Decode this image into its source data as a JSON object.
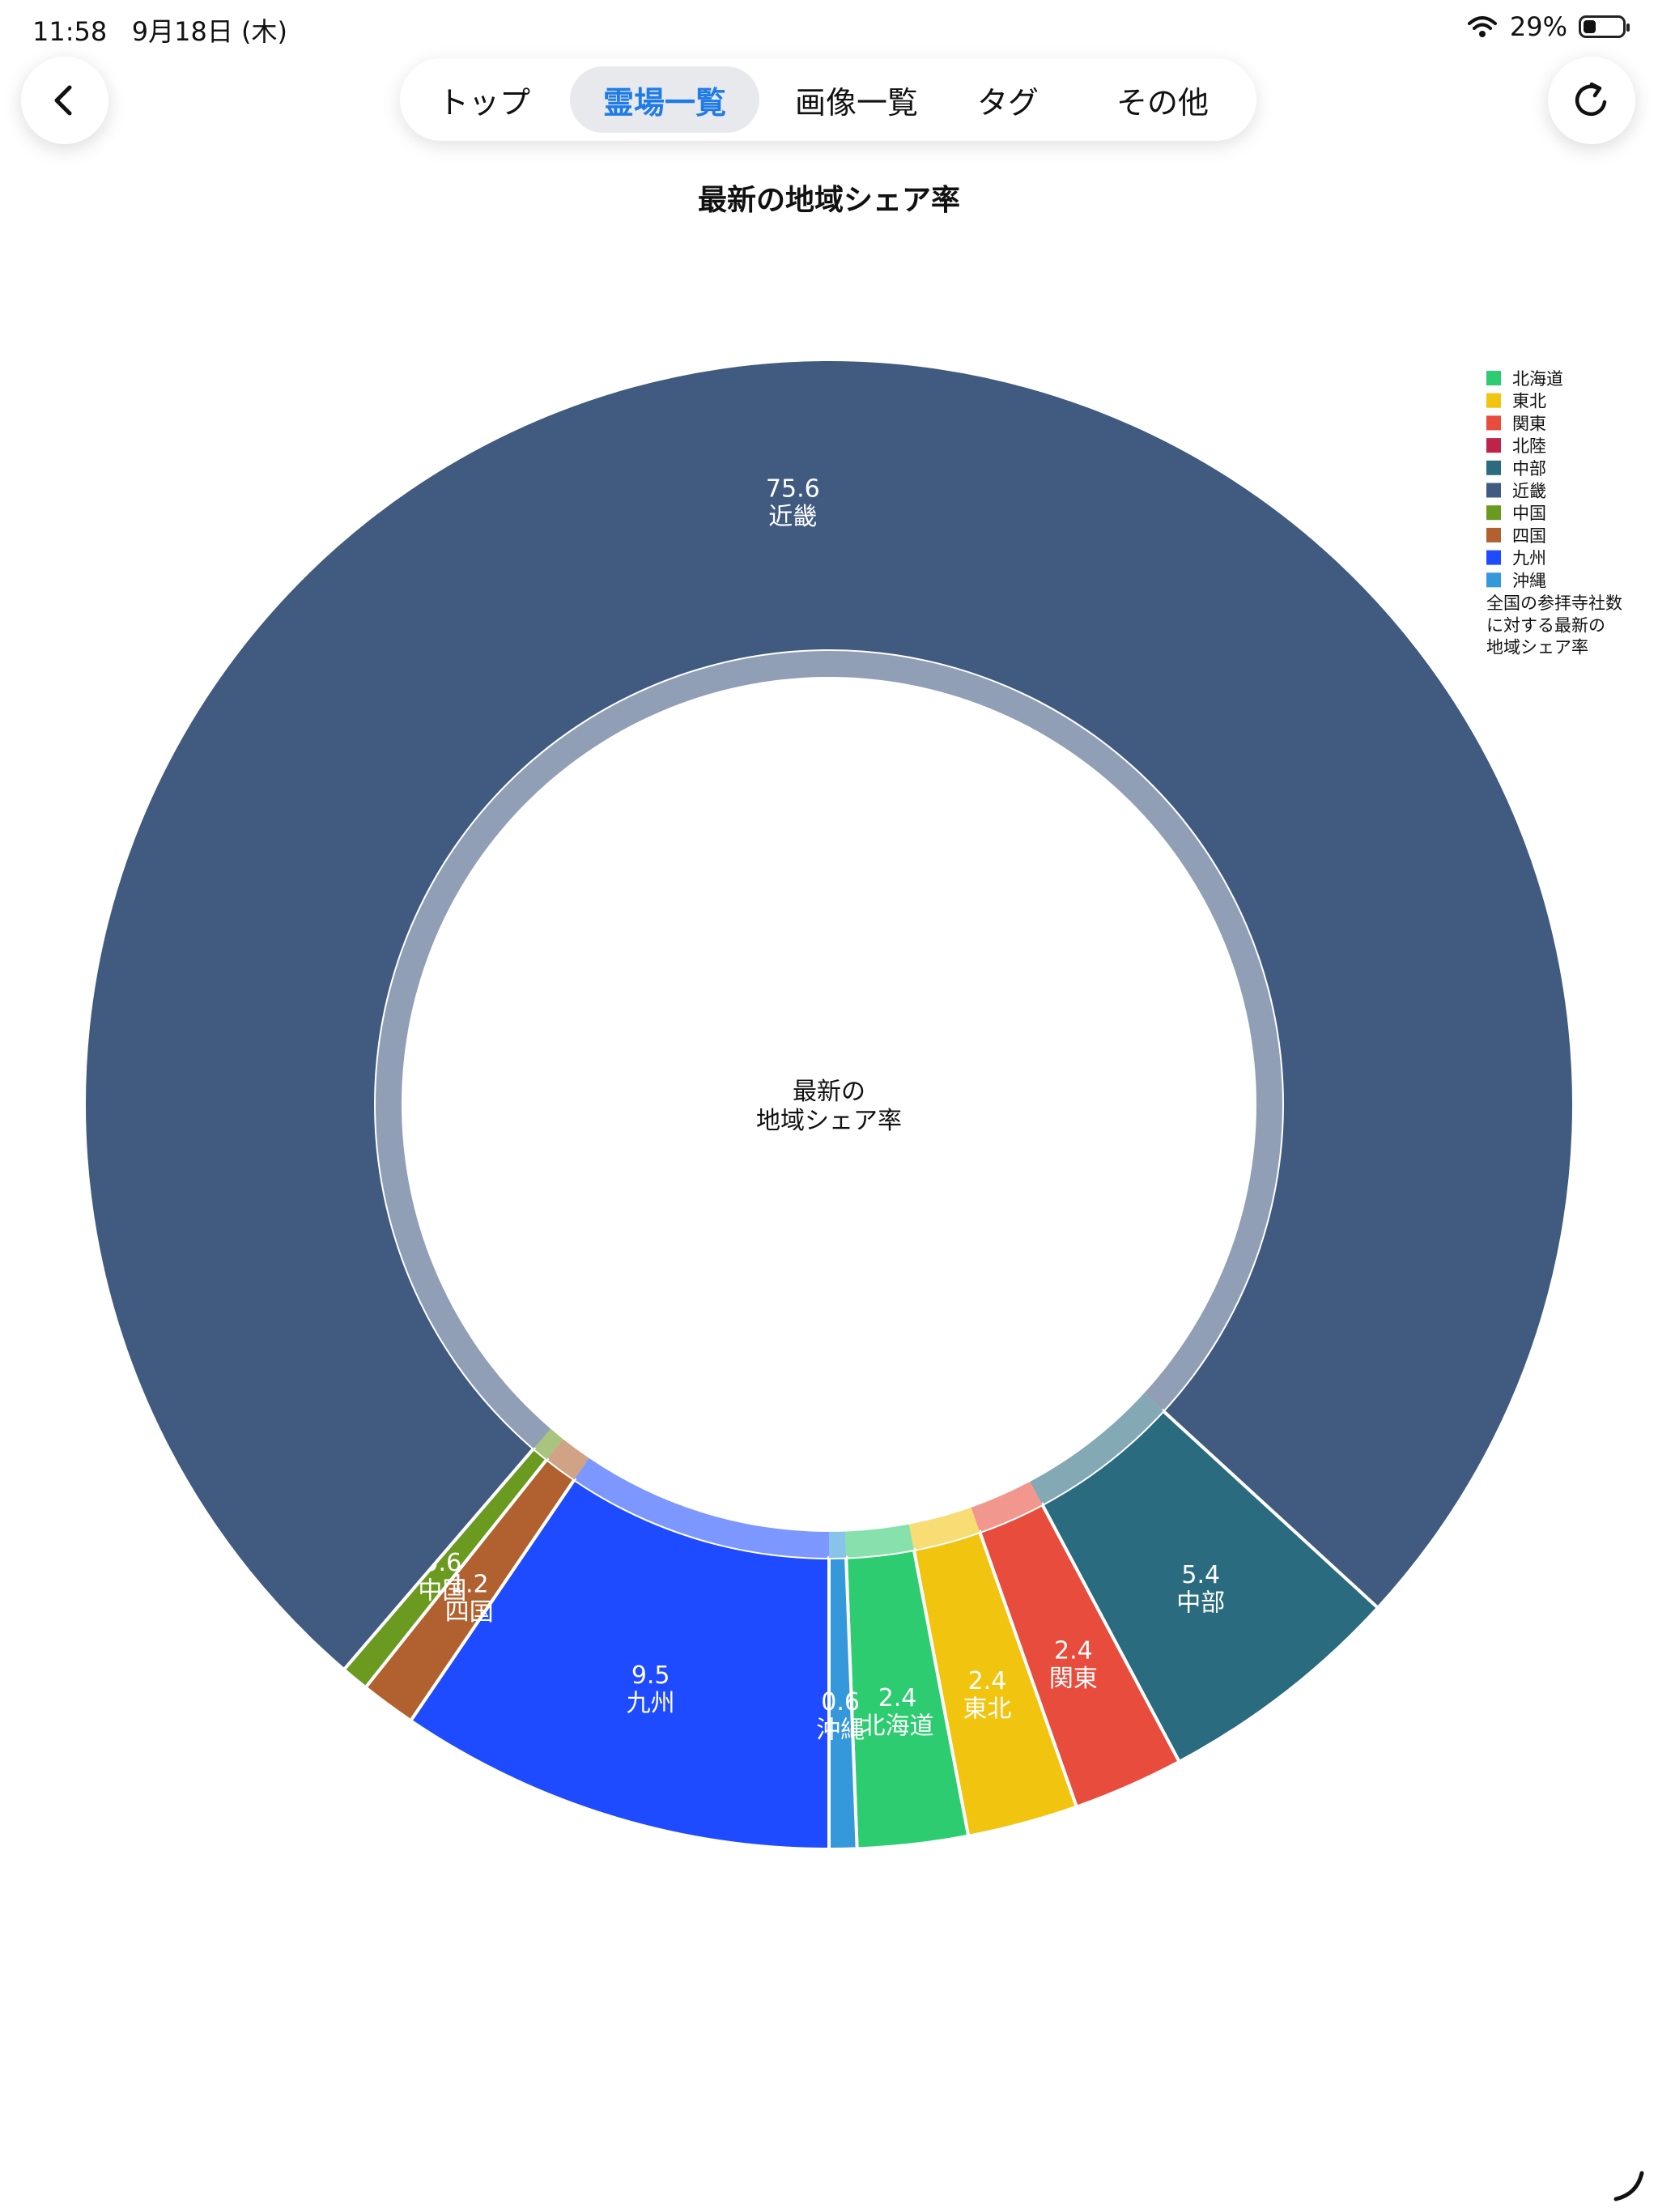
{
  "status_bar": {
    "time": "11:58",
    "date": "9月18日 (木)",
    "battery": "29%",
    "battery_level": 0.29
  },
  "nav": {
    "back_icon": "chevron-left-icon",
    "refresh_icon": "refresh-icon",
    "tabs": [
      {
        "label": "トップ",
        "active": false
      },
      {
        "label": "霊場一覧",
        "active": true
      },
      {
        "label": "画像一覧",
        "active": false
      },
      {
        "label": "タグ",
        "active": false
      },
      {
        "label": "その他",
        "active": false
      }
    ],
    "accent_color": "#1f7be8"
  },
  "chart_data": {
    "type": "pie",
    "title": "最新の地域シェア率",
    "center_label": "最新の\n地域シェア率",
    "legend_placement": "top-right",
    "legend_title": "全国の参拝寺社数\nに対する最新の\n地域シェア率",
    "categories": [
      "北海道",
      "東北",
      "関東",
      "北陸",
      "中部",
      "近畿",
      "中国",
      "四国",
      "九州",
      "沖縄"
    ],
    "values": [
      2.4,
      2.4,
      2.4,
      0,
      5.4,
      75.6,
      0.6,
      1.2,
      9.5,
      0.6
    ],
    "value_labels": [
      "2.4",
      "2.4",
      "2.4",
      "",
      "5.4",
      "75.6",
      "0.6",
      "1.2",
      "9.5",
      "0.6"
    ],
    "colors": [
      "#2ecc71",
      "#f1c40f",
      "#e74c3c",
      "#c0234a",
      "#2a6b7f",
      "#405a80",
      "#6b9a20",
      "#b0612f",
      "#1e4bff",
      "#3498db"
    ]
  }
}
